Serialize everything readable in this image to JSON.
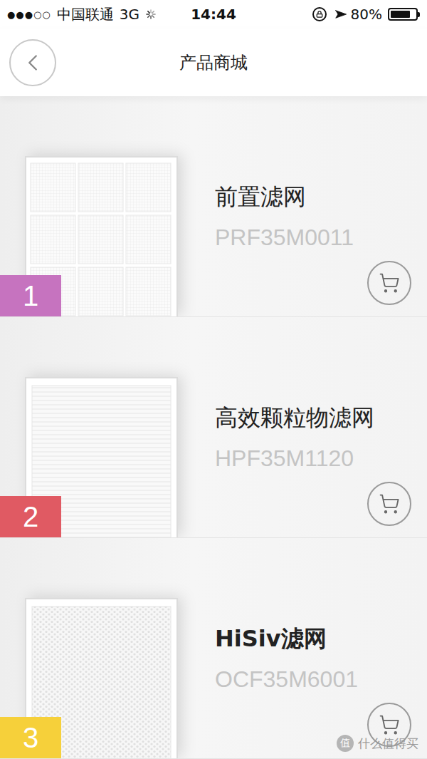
{
  "status_bar": {
    "signal": "●●●○○",
    "carrier": "中国联通",
    "network": "3G",
    "time": "14:44",
    "battery": "80%",
    "battery_level": 0.8
  },
  "nav": {
    "title": "产品商城"
  },
  "products": [
    {
      "index": "1",
      "name": "前置滤网",
      "model": "PRF35M0011",
      "color": "#c673bf",
      "kind": "grid",
      "bold": false
    },
    {
      "index": "2",
      "name": "高效颗粒物滤网",
      "model": "HPF35M1120",
      "color": "#e05a63",
      "kind": "pleated",
      "bold": false
    },
    {
      "index": "3",
      "name": "HiSiv滤网",
      "model": "OCF35M6001",
      "color": "#f6d03a",
      "kind": "honeycomb",
      "bold": true
    }
  ],
  "watermark": {
    "logo": "值",
    "text": "什么值得买"
  }
}
